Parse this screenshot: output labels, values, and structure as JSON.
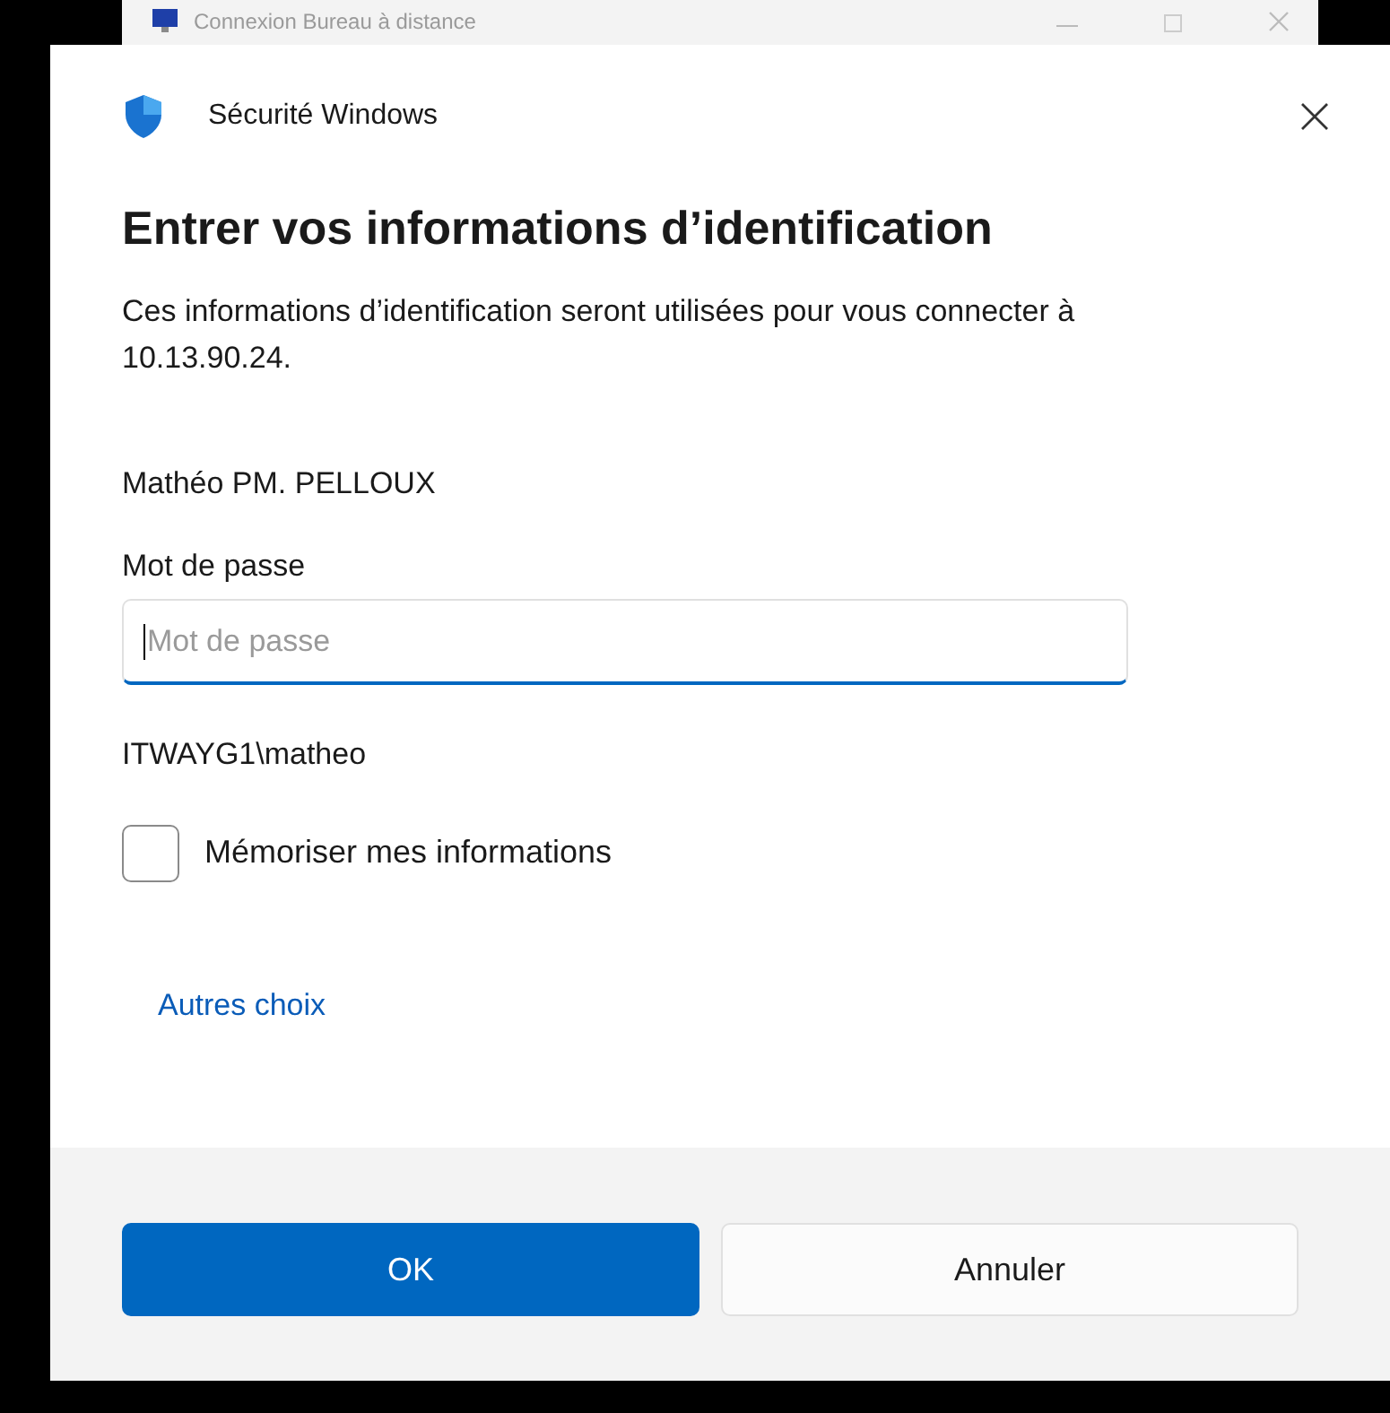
{
  "background_window": {
    "title": "Connexion Bureau à distance"
  },
  "dialog": {
    "app_title": "Sécurité Windows",
    "heading": "Entrer vos informations d’identification",
    "description": "Ces informations d’identification seront utilisées pour vous connecter à 10.13.90.24.",
    "user_name": "Mathéo PM. PELLOUX",
    "password_label": "Mot de passe",
    "password_field": {
      "placeholder": "Mot de passe",
      "focused": true
    },
    "domain": "ITWAYG1\\matheo",
    "remember": {
      "label": "Mémoriser mes informations",
      "checked": false
    },
    "more_choices": "Autres choix",
    "buttons": [
      {
        "label": "OK",
        "kind": "primary"
      },
      {
        "label": "Annuler",
        "kind": "secondary"
      }
    ]
  }
}
